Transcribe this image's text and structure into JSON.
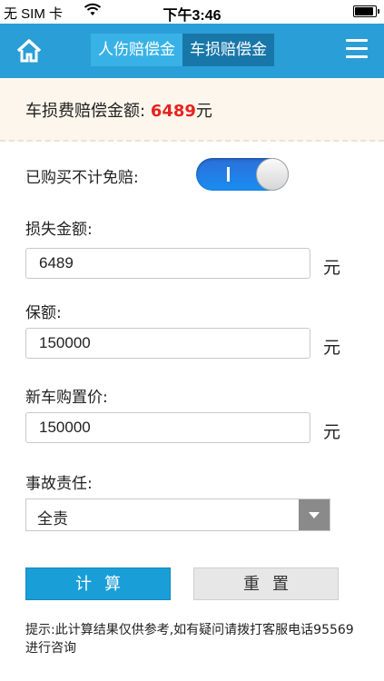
{
  "status_bar": {
    "carrier": "无 SIM 卡",
    "time": "下午3:46"
  },
  "nav": {
    "tabs": [
      {
        "label": "人伤赔偿金"
      },
      {
        "label": "车损赔偿金"
      }
    ],
    "active_tab": 1
  },
  "result": {
    "label": "车损费赔偿金额:",
    "amount": "6489",
    "unit": "元"
  },
  "form": {
    "deductible": {
      "label": "已购买不计免赔:",
      "on": true,
      "on_text": "I"
    },
    "loss": {
      "label": "损失金额:",
      "value": "6489",
      "unit": "元"
    },
    "insured": {
      "label": "保额:",
      "value": "150000",
      "unit": "元"
    },
    "new_price": {
      "label": "新车购置价:",
      "value": "150000",
      "unit": "元"
    },
    "liability": {
      "label": "事故责任:",
      "selected": "全责"
    }
  },
  "buttons": {
    "calc": "计算",
    "reset": "重置"
  },
  "hint": "提示:此计算结果仅供参考,如有疑问请拨打客服电话95569进行咨询",
  "colors": {
    "nav": "#2a9ed6",
    "accent": "#e5231f",
    "primary_button": "#1a9ed8"
  },
  "icons": {
    "home": "home-icon",
    "menu": "menu-icon",
    "select": "chevron-down-icon"
  }
}
